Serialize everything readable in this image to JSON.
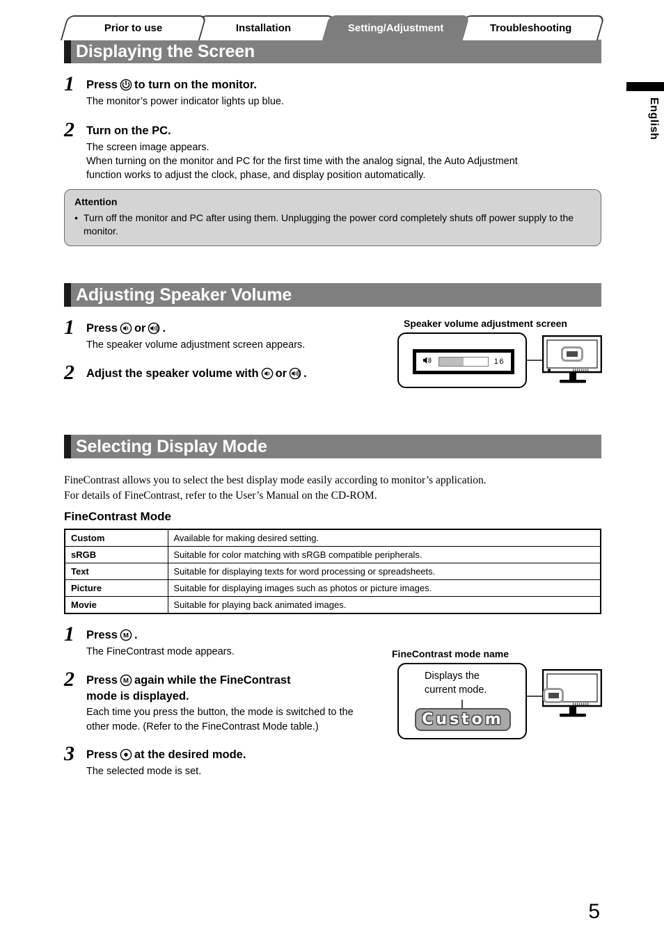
{
  "tabs": [
    {
      "label": "Prior to use",
      "active": false
    },
    {
      "label": "Installation",
      "active": false
    },
    {
      "label": "Setting/Adjustment",
      "active": true
    },
    {
      "label": "Troubleshooting",
      "active": false
    }
  ],
  "language_tab": {
    "label": "English"
  },
  "page_number": "5",
  "sections": {
    "displaying_the_screen": {
      "title": "Displaying the Screen",
      "steps": [
        {
          "number": "1",
          "heading_before": "Press",
          "icon": "power-button-icon",
          "heading_after": "to turn on the monitor.",
          "text": "The monitor’s power indicator lights up blue."
        },
        {
          "number": "2",
          "heading": "Turn on the PC.",
          "text_line1": "The screen image appears.",
          "text_line2": "When turning on the monitor and PC for the first time with the analog signal, the Auto Adjustment",
          "text_line3": "function works to adjust the clock, phase, and display position automatically."
        }
      ],
      "attention": {
        "title": "Attention",
        "bullet": "•",
        "text": "Turn off the monitor and PC after using them. Unplugging the power cord completely shuts off power supply to the monitor."
      }
    },
    "adjusting_speaker_volume": {
      "title": "Adjusting Speaker Volume",
      "steps": [
        {
          "number": "1",
          "heading_before": "Press",
          "icon_low": "volume-down-icon",
          "heading_middle": "or",
          "icon_high": "volume-up-icon",
          "heading_after": ".",
          "text": "The speaker volume adjustment screen appears."
        },
        {
          "number": "2",
          "heading_before": "Adjust the speaker volume with",
          "icon_low": "volume-down-icon",
          "heading_middle": "or",
          "icon_high": "volume-up-icon",
          "heading_after": "."
        }
      ],
      "figure": {
        "caption": "Speaker volume adjustment screen",
        "osd": {
          "icon": "speaker-icon",
          "bar_fill_percent": 50,
          "value": "16"
        }
      }
    },
    "selecting_display_mode": {
      "title": "Selecting Display Mode",
      "intro_line1": "FineContrast allows you to select the best display mode easily according to monitor’s application.",
      "intro_line2": "For details of FineContrast, refer to the User’s Manual on the CD-ROM.",
      "subheading": "FineContrast Mode",
      "table": {
        "rows": [
          {
            "mode": "Custom",
            "description": "Available for making desired setting."
          },
          {
            "mode": "sRGB",
            "description": "Suitable for color matching with sRGB compatible peripherals."
          },
          {
            "mode": "Text",
            "description": "Suitable for displaying texts for word processing or spreadsheets."
          },
          {
            "mode": "Picture",
            "description": "Suitable for displaying images such as photos or picture images."
          },
          {
            "mode": "Movie",
            "description": "Suitable for playing back animated images."
          }
        ]
      },
      "steps": [
        {
          "number": "1",
          "heading_before": "Press",
          "icon": "mode-button-icon",
          "heading_after": ".",
          "text": "The FineContrast mode appears."
        },
        {
          "number": "2",
          "heading_before": "Press",
          "icon": "mode-button-icon",
          "heading_after": "again while the FineContrast",
          "heading_line2": "mode is displayed.",
          "text_line1": "Each time you press the button, the mode is switched to the",
          "text_line2": "other mode. (Refer to the FineContrast Mode table.)"
        },
        {
          "number": "3",
          "heading_before": "Press",
          "icon": "enter-button-icon",
          "heading_after": "at the desired mode.",
          "text": "The selected mode is set."
        }
      ],
      "figure": {
        "caption": "FineContrast mode name",
        "note_line1": "Displays the",
        "note_line2": "current mode.",
        "osd_mode_name": "Custom"
      }
    }
  },
  "colors": {
    "section_bar": "#808080",
    "active_tab": "#7d7d7d",
    "attention_bg": "#d4d4d4",
    "osd_fill": "#bdbdbd",
    "osd_custom_bg": "#a8a8a8"
  }
}
